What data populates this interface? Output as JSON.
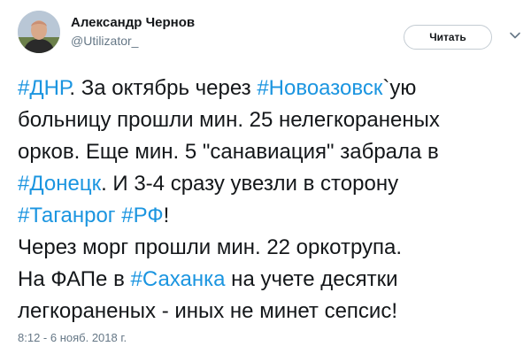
{
  "author": {
    "name": "Александр Чернов",
    "handle": "@Utilizator_"
  },
  "follow_button": {
    "label": "Читать"
  },
  "tweet": {
    "lines": [
      {
        "parts": [
          {
            "t": "#ДНР",
            "h": true
          },
          {
            "t": ". За октябрь через "
          },
          {
            "t": "#Новоазовск",
            "h": true
          },
          {
            "t": "`ую"
          }
        ]
      },
      {
        "parts": [
          {
            "t": "больницу прошли мин. 25 нелегкораненых"
          }
        ]
      },
      {
        "parts": [
          {
            "t": "орков. Еще мин. 5 \"санавиация\" забрала в"
          }
        ]
      },
      {
        "parts": [
          {
            "t": "#Донецк",
            "h": true
          },
          {
            "t": ". И 3-4 сразу увезли в сторону"
          }
        ]
      },
      {
        "parts": [
          {
            "t": "#Таганрог",
            "h": true
          },
          {
            "t": " "
          },
          {
            "t": "#РФ",
            "h": true
          },
          {
            "t": "!"
          }
        ]
      },
      {
        "parts": [
          {
            "t": "Через морг прошли мин. 22 оркотрупа."
          }
        ]
      },
      {
        "parts": [
          {
            "t": "На ФАПе в "
          },
          {
            "t": "#Саханка",
            "h": true
          },
          {
            "t": " на учете десятки"
          }
        ]
      },
      {
        "parts": [
          {
            "t": "легкораненых - иных не минет сепсис!"
          }
        ]
      }
    ],
    "timestamp": "8:12 - 6 нояб. 2018 г."
  },
  "colors": {
    "hashtag": "#1b95e0",
    "text": "#14171a",
    "muted": "#657786"
  },
  "icons": {
    "avatar": "user-avatar-photo",
    "more": "chevron-down-icon"
  }
}
